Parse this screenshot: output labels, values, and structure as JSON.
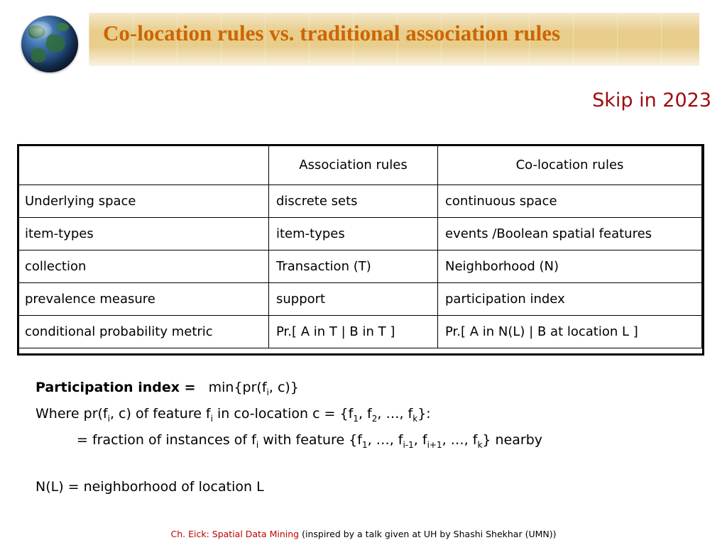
{
  "slide": {
    "title": "Co-location rules vs. traditional association rules",
    "skip_note": "Skip in 2023",
    "accent_title_color": "#cc6600",
    "banner_color": "#e8cd8b",
    "skip_note_color": "#9e0b0f"
  },
  "icons": {
    "globe": "globe-icon"
  },
  "table": {
    "headers": [
      "",
      "Association rules",
      "Co-location rules"
    ],
    "rows": [
      [
        "Underlying  space",
        "discrete sets",
        "continuous space"
      ],
      [
        "item-types",
        "item-types",
        "events /Boolean spatial features"
      ],
      [
        "collection",
        "Transaction (T)",
        "Neighborhood (N)"
      ],
      [
        "prevalence measure",
        "support",
        "participation index"
      ],
      [
        "conditional probability metric",
        "Pr.[ A in T | B in T ]",
        "Pr.[ A in N(L) | B at location L ]"
      ]
    ]
  },
  "notes": {
    "line1_bold": "Participation index  =",
    "line1_rest": "min{pr(f",
    "line1_sub": "i",
    "line1_tail": ", c)}",
    "line2_a": "Where pr(f",
    "line2_sub1": "i",
    "line2_b": ", c) of feature f",
    "line2_sub2": "i",
    "line2_c": " in co-location c  = {f",
    "line2_sub3": "1",
    "line2_d": ", f",
    "line2_sub4": "2",
    "line2_e": ", …, f",
    "line2_sub5": "k",
    "line2_f": "}:",
    "line3_a": "= fraction of instances of f",
    "line3_sub1": "i",
    "line3_b": " with feature {f",
    "line3_sub2": "1",
    "line3_c": ", …, f",
    "line3_sub3": "i-1",
    "line3_d": ",  f",
    "line3_sub4": "i+1",
    "line3_e": ", …, f",
    "line3_sub5": "k",
    "line3_f": "} nearby",
    "line4": "N(L) = neighborhood of location L"
  },
  "footer": {
    "red_text": "Ch. Eick: Spatial Data Mining",
    "black_text": "(inspired by a talk given at UH by Shashi Shekhar (UMN))"
  }
}
